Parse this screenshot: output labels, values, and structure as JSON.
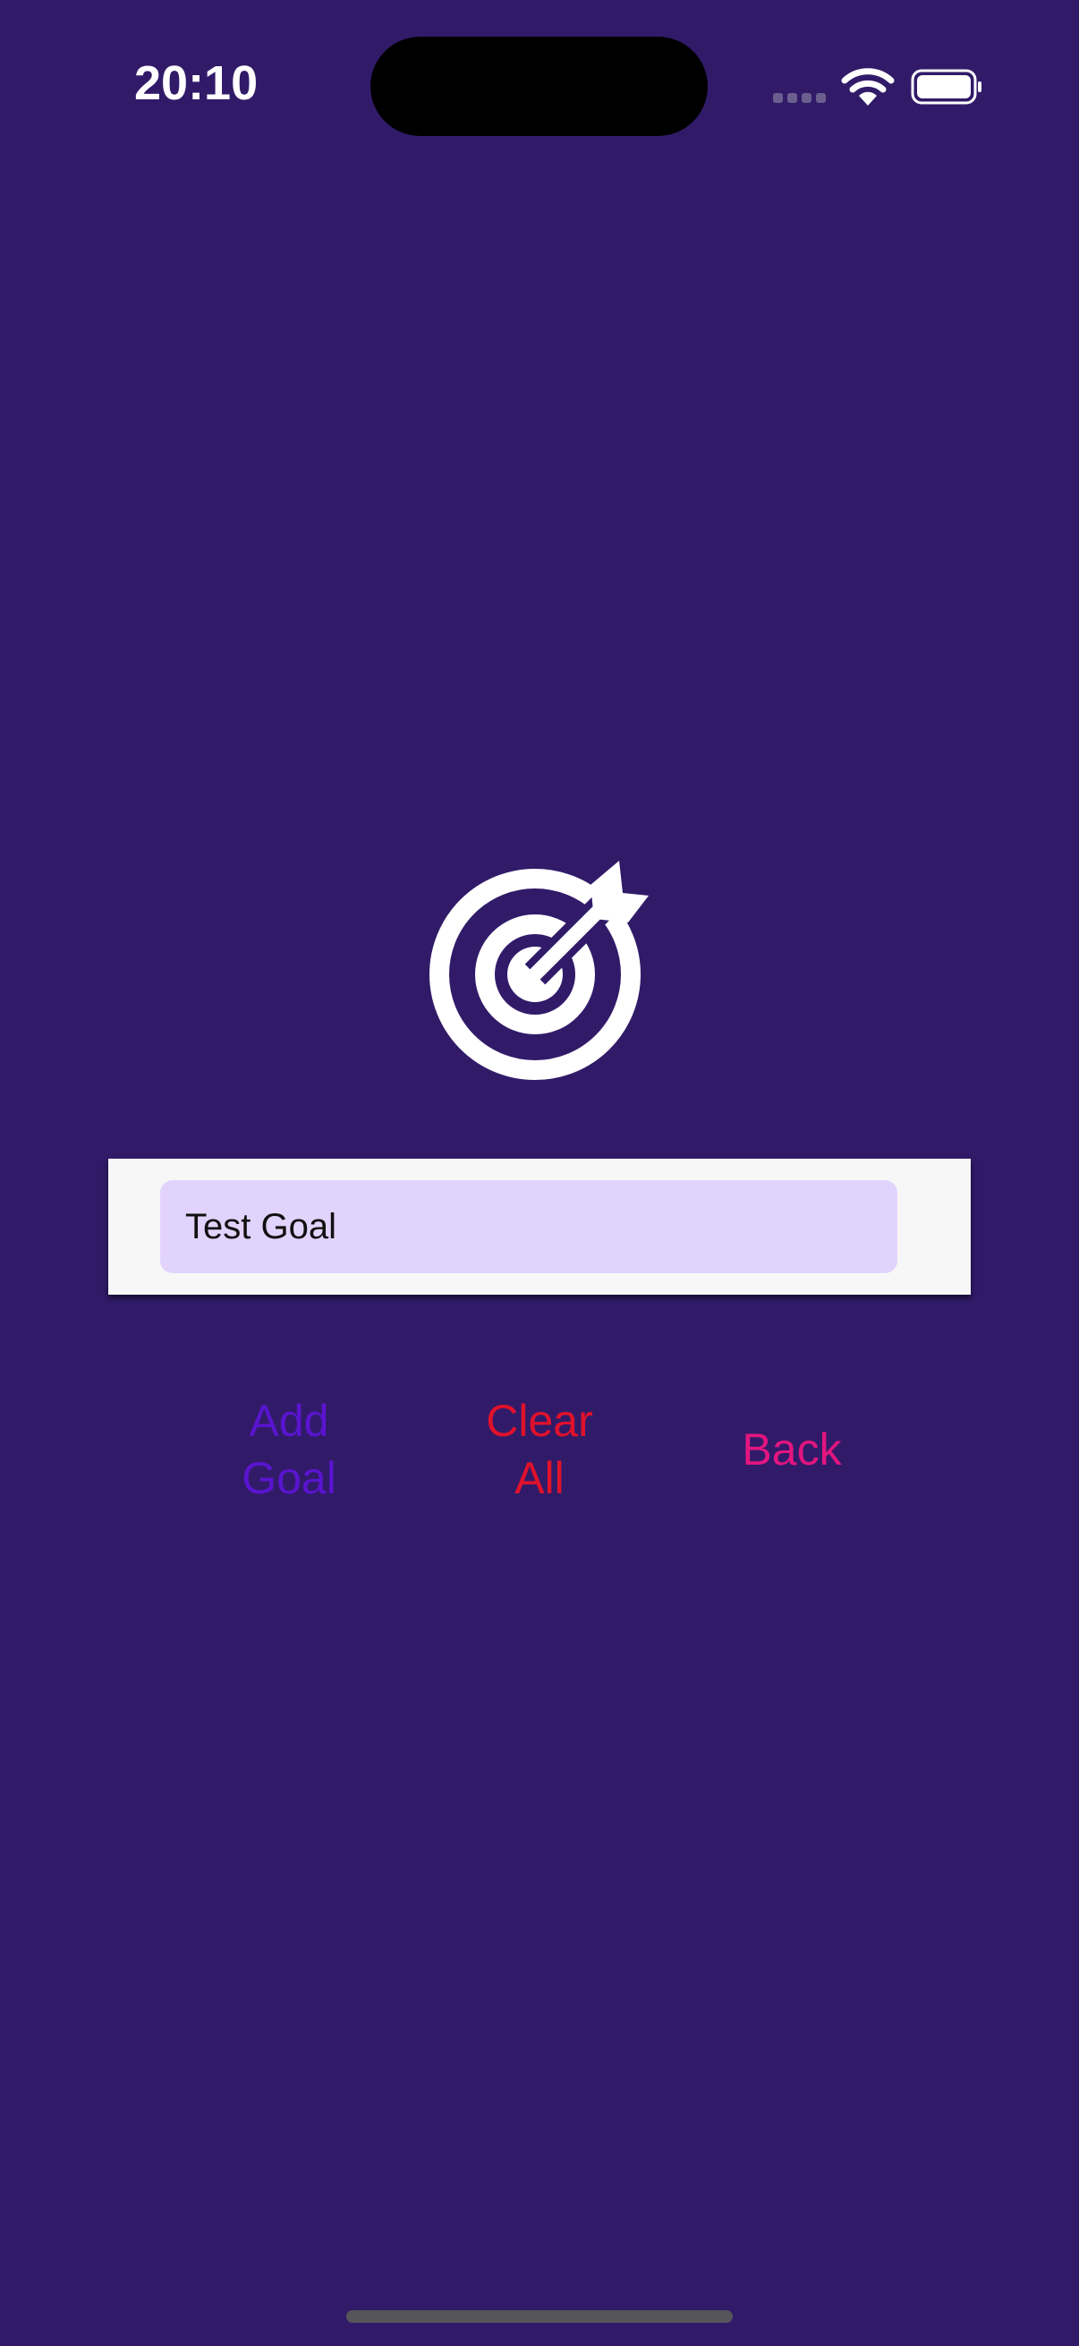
{
  "status_bar": {
    "time": "20:10",
    "icons": [
      "cellular-signal-icon",
      "wifi-icon",
      "battery-icon"
    ]
  },
  "main": {
    "icon": "target-arrow-icon",
    "goal_input": {
      "value": "Test Goal",
      "placeholder": ""
    },
    "buttons": {
      "add_goal": {
        "line1": "Add",
        "line2": "Goal",
        "color": "#5a14cf"
      },
      "clear_all": {
        "line1": "Clear",
        "line2": "All",
        "color": "#e0122b"
      },
      "back": {
        "label": "Back",
        "color": "#e2157f"
      }
    }
  },
  "colors": {
    "background": "#311b69",
    "card": "#f7f7f8",
    "input_fill": "#e2d3fc"
  }
}
